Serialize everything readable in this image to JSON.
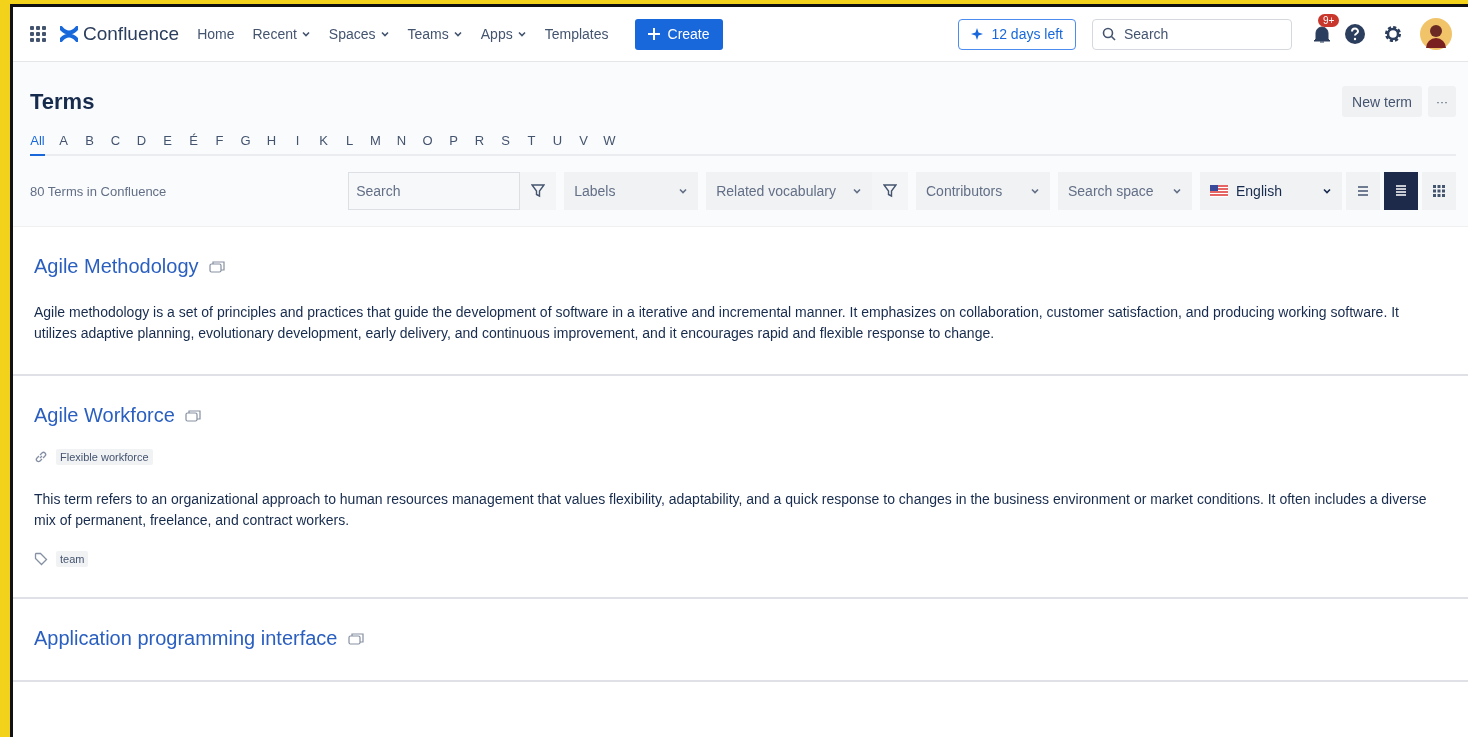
{
  "nav": {
    "app_name": "Confluence",
    "items": [
      {
        "label": "Home",
        "dropdown": false
      },
      {
        "label": "Recent",
        "dropdown": true
      },
      {
        "label": "Spaces",
        "dropdown": true
      },
      {
        "label": "Teams",
        "dropdown": true
      },
      {
        "label": "Apps",
        "dropdown": true
      },
      {
        "label": "Templates",
        "dropdown": false
      }
    ],
    "create_button": "Create",
    "trial_button": "12 days left",
    "search": {
      "placeholder": "Search"
    },
    "notification_badge": "9+"
  },
  "page": {
    "title": "Terms",
    "new_term_button": "New term",
    "more_button": "···"
  },
  "alphabet": [
    {
      "label": "All",
      "selected": true
    },
    {
      "label": "A",
      "selected": false
    },
    {
      "label": "B",
      "selected": false
    },
    {
      "label": "C",
      "selected": false
    },
    {
      "label": "D",
      "selected": false
    },
    {
      "label": "E",
      "selected": false
    },
    {
      "label": "É",
      "selected": false
    },
    {
      "label": "F",
      "selected": false
    },
    {
      "label": "G",
      "selected": false
    },
    {
      "label": "H",
      "selected": false
    },
    {
      "label": "I",
      "selected": false
    },
    {
      "label": "K",
      "selected": false
    },
    {
      "label": "L",
      "selected": false
    },
    {
      "label": "M",
      "selected": false
    },
    {
      "label": "N",
      "selected": false
    },
    {
      "label": "O",
      "selected": false
    },
    {
      "label": "P",
      "selected": false
    },
    {
      "label": "R",
      "selected": false
    },
    {
      "label": "S",
      "selected": false
    },
    {
      "label": "T",
      "selected": false
    },
    {
      "label": "U",
      "selected": false
    },
    {
      "label": "V",
      "selected": false
    },
    {
      "label": "W",
      "selected": false
    }
  ],
  "count": "80 Terms in Confluence",
  "filters": [
    {
      "kind": "search",
      "placeholder": "Search",
      "filter_button": true
    },
    {
      "kind": "select",
      "label": "Labels",
      "filter_button": false
    },
    {
      "kind": "select",
      "label": "Related vocabulary",
      "filter_button": true
    },
    {
      "kind": "select",
      "label": "Contributors",
      "filter_button": false
    },
    {
      "kind": "select",
      "label": "Search space",
      "filter_button": false
    },
    {
      "kind": "language",
      "label": "English",
      "filter_button": false
    }
  ],
  "view_modes": [
    {
      "kind": "compact",
      "selected": false
    },
    {
      "kind": "list",
      "selected": true
    },
    {
      "kind": "grid",
      "selected": false
    }
  ],
  "terms": [
    {
      "title": "Agile Methodology",
      "description": "Agile methodology is a set of principles and practices that guide the development of software in a iterative and incremental manner. It emphasizes on collaboration, customer satisfaction, and producing working software. It utilizes adaptive planning, evolutionary development, early delivery, and continuous improvement, and it encourages rapid and flexible response to change."
    },
    {
      "title": "Agile Workforce",
      "synonyms": [
        "Flexible workforce"
      ],
      "description": "This term refers to an organizational approach to human resources management that values flexibility, adaptability, and a quick response to changes in the business environment or market conditions. It often includes a diverse mix of permanent, freelance, and contract workers.",
      "labels": [
        "team"
      ]
    },
    {
      "title": "Application programming interface"
    }
  ]
}
